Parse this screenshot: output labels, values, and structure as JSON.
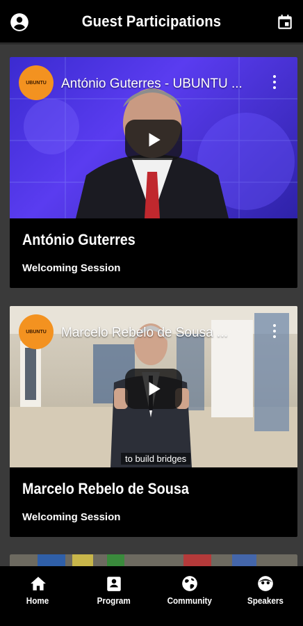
{
  "header": {
    "title": "Guest Participations",
    "left_icon": "account-circle-icon",
    "right_icon": "calendar-icon"
  },
  "cards": [
    {
      "video_title": "António Guterres - UBUNTU ...",
      "channel_logo_text": "UBUNTU",
      "name": "António Guterres",
      "session": "Welcoming Session",
      "caption": ""
    },
    {
      "video_title": "Marcelo Rebelo de Sousa ...",
      "channel_logo_text": "UBUNTU",
      "name": "Marcelo Rebelo de Sousa",
      "session": "Welcoming Session",
      "caption": "to build bridges"
    }
  ],
  "nav": {
    "items": [
      {
        "label": "Home",
        "icon": "home-icon"
      },
      {
        "label": "Program",
        "icon": "program-icon"
      },
      {
        "label": "Community",
        "icon": "globe-icon"
      },
      {
        "label": "Speakers",
        "icon": "speakers-icon"
      }
    ]
  },
  "colors": {
    "background": "#3a3a3a",
    "bar": "#000000",
    "channel_logo": "#f39220"
  }
}
